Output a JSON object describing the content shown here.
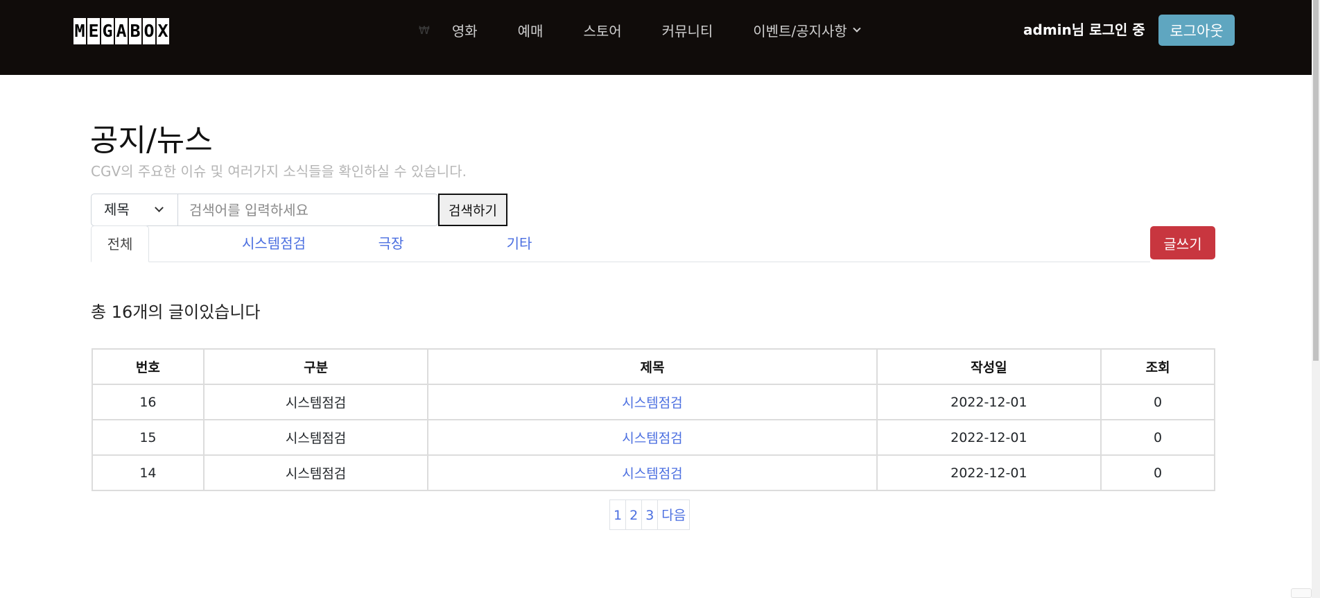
{
  "header": {
    "logo_letters": [
      "M",
      "E",
      "G",
      "A",
      "B",
      "O",
      "X"
    ],
    "won_symbol": "₩",
    "nav_items": [
      "영화",
      "예매",
      "스토어",
      "커뮤니티"
    ],
    "nav_dropdown": "이벤트/공지사항",
    "user_status": "admin님 로그인 중",
    "logout_label": "로그아웃"
  },
  "page": {
    "title": "공지/뉴스",
    "subtitle": "CGV의 주요한 이슈 및 여러가지 소식들을 확인하실 수 있습니다."
  },
  "search": {
    "select_value": "제목",
    "placeholder": "검색어를 입력하세요",
    "button_label": "검색하기"
  },
  "tabs": [
    "전체",
    "시스템점검",
    "극장",
    "기타"
  ],
  "write_label": "글쓰기",
  "total_text": "총 16개의 글이있습니다",
  "table": {
    "headers": [
      "번호",
      "구분",
      "제목",
      "작성일",
      "조회"
    ],
    "rows": [
      {
        "no": "16",
        "category": "시스템점검",
        "title": "시스템점검",
        "date": "2022-12-01",
        "views": "0"
      },
      {
        "no": "15",
        "category": "시스템점검",
        "title": "시스템점검",
        "date": "2022-12-01",
        "views": "0"
      },
      {
        "no": "14",
        "category": "시스템점검",
        "title": "시스템점검",
        "date": "2022-12-01",
        "views": "0"
      }
    ]
  },
  "pagination": [
    "1",
    "2",
    "3",
    "다음"
  ],
  "colors": {
    "header_bg": "#100c0a",
    "logout_btn": "#5fa6c0",
    "write_btn": "#c8363f",
    "link": "#4a6ee0"
  }
}
